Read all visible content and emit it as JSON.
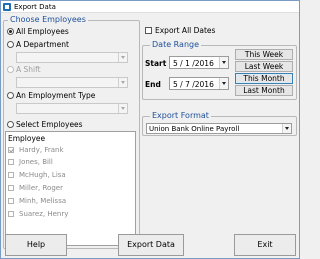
{
  "window": {
    "title": "Export Data"
  },
  "choose_employees": {
    "group_label": "Choose Employees",
    "all_employees_label": "All Employees",
    "department_label": "A Department",
    "shift_label": "A Shift",
    "employment_type_label": "An Employment Type",
    "select_employees_label": "Select Employees",
    "selected_option": "All Employees"
  },
  "employee_list": {
    "header": "Employee",
    "items": [
      {
        "name": "Hardy, Frank",
        "checked": true
      },
      {
        "name": "Jones, Bill",
        "checked": false
      },
      {
        "name": "McHugh, Lisa",
        "checked": false
      },
      {
        "name": "Miller, Roger",
        "checked": false
      },
      {
        "name": "Minh, Melissa",
        "checked": false
      },
      {
        "name": "Suarez, Henry",
        "checked": false
      }
    ]
  },
  "export_all_dates": {
    "label": "Export All Dates",
    "checked": false
  },
  "date_range": {
    "group_label": "Date Range",
    "start_label": "Start",
    "start_value": "5 / 1 /2016",
    "end_label": "End",
    "end_value": "5 / 7 /2016",
    "this_week_label": "This Week",
    "last_week_label": "Last Week",
    "this_month_label": "This Month",
    "last_month_label": "Last Month"
  },
  "export_format": {
    "group_label": "Export Format",
    "selected": "Union Bank Online Payroll"
  },
  "footer": {
    "help_label": "Help",
    "export_label": "Export Data",
    "exit_label": "Exit"
  },
  "colors": {
    "group_label": "#1d4f9a",
    "window_bg": "#f0f0f0",
    "focus_border": "#3c7fb1"
  }
}
